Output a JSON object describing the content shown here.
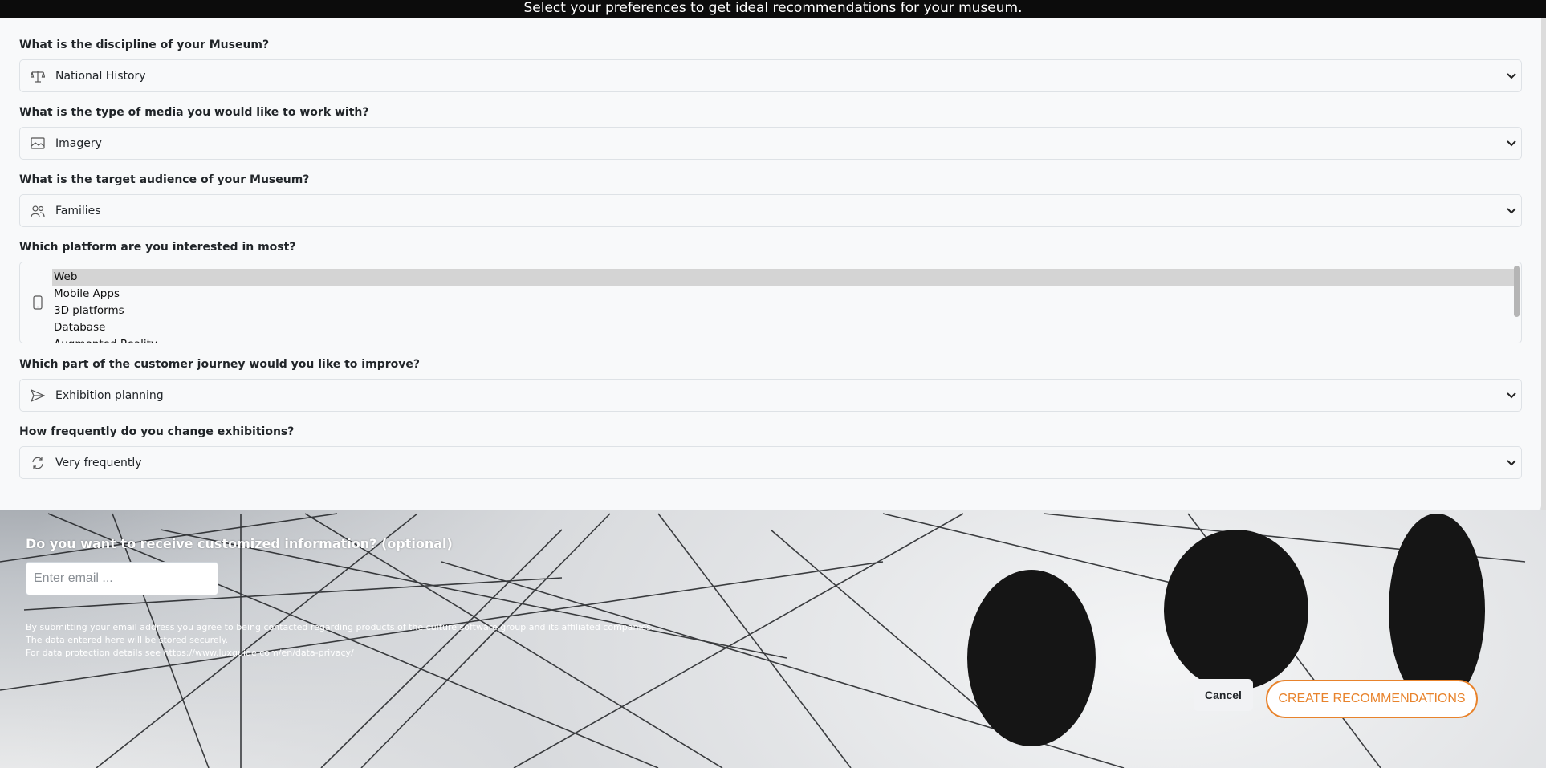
{
  "header": {
    "title": "Select your preferences to get ideal recommendations for your museum."
  },
  "form": {
    "discipline": {
      "question": "What is the discipline of your Museum?",
      "value": "National History",
      "icon": "scales-icon"
    },
    "media": {
      "question": "What is the type of media you would like to work with?",
      "value": "Imagery",
      "icon": "image-icon"
    },
    "audience": {
      "question": "What is the target audience of your Museum?",
      "value": "Families",
      "icon": "people-icon"
    },
    "platform": {
      "question": "Which platform are you interested in most?",
      "icon": "mobile-phone-icon",
      "options": [
        "Web",
        "Mobile Apps",
        "3D platforms",
        "Database",
        "Augmented Reality"
      ],
      "selected": "Web"
    },
    "journey": {
      "question": "Which part of the customer journey would you like to improve?",
      "value": "Exhibition planning",
      "icon": "send-icon"
    },
    "frequency": {
      "question": "How frequently do you change exhibitions?",
      "value": "Very frequently",
      "icon": "refresh-icon"
    }
  },
  "email": {
    "question": "Do you want to receive customized information? (optional)",
    "placeholder": "Enter email ...",
    "legal": [
      "By submitting your email address you agree to being contacted regarding products of the culture software group and its affiliated companies.",
      "The data entered here will be stored securely.",
      "For data protection details see https://www.luxguide.com/en/data-privacy/"
    ]
  },
  "actions": {
    "cancel": "Cancel",
    "create": "CREATE RECOMMENDATIONS"
  },
  "colors": {
    "accent": "#e8832c",
    "topbar": "#0c0c0c"
  }
}
